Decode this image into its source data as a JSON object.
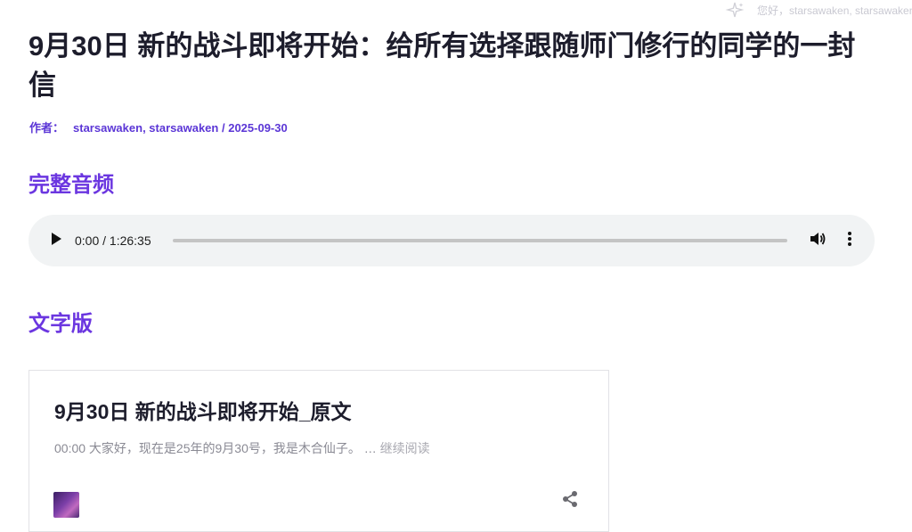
{
  "header": {
    "greeting": "您好，starsawaken, starsawaken"
  },
  "post": {
    "title": "9月30日 新的战斗即将开始：给所有选择跟随师门修行的同学的一封信",
    "author_label": "作者：",
    "author": "starsawaken, starsawaken",
    "separator": "/",
    "date": "2025-09-30"
  },
  "sections": {
    "audio_heading": "完整音频",
    "text_heading": "文字版"
  },
  "audio_player": {
    "time_display": "0:00 / 1:26:35",
    "progress_fraction": 0
  },
  "card": {
    "title": "9月30日 新的战斗即将开始_原文",
    "excerpt": "00:00 大家好，现在是25年的9月30号，我是木合仙子。",
    "ellipsis": "…",
    "read_more": "继续阅读"
  },
  "icons": {
    "greeting": "sparkle-icon",
    "play": "play-icon",
    "volume": "volume-icon",
    "more": "more-vertical-icon",
    "share": "share-icon"
  },
  "colors": {
    "accent": "#6b36e0",
    "meta": "#5b36d6",
    "player_bg": "#f1f3f4"
  }
}
